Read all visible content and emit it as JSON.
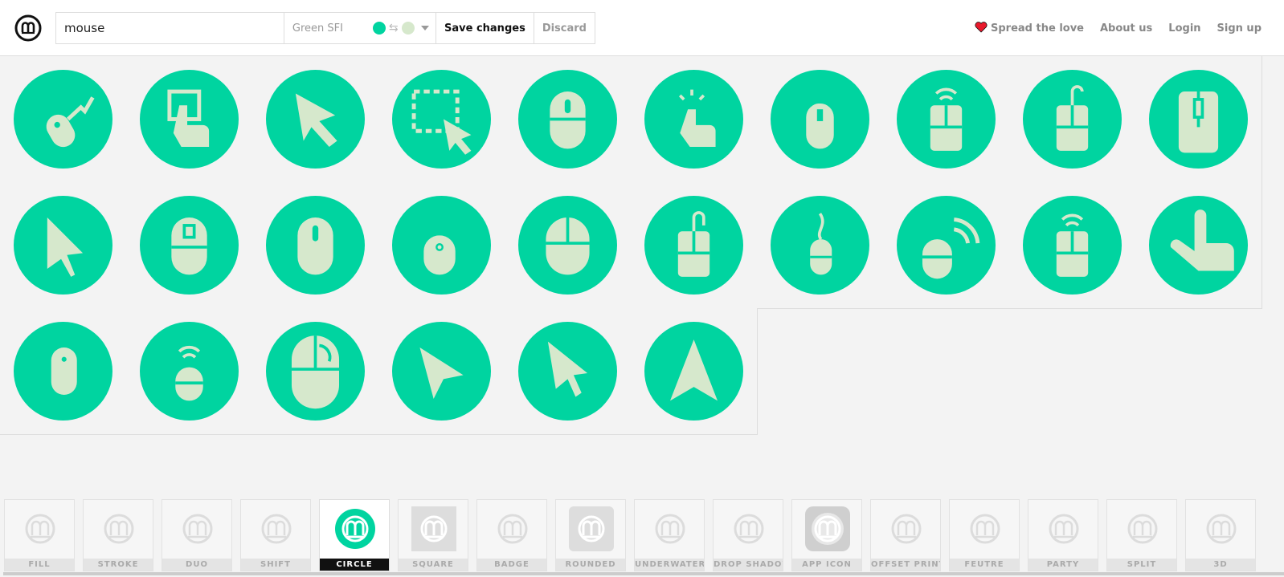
{
  "colors": {
    "accent": "#00d4a0",
    "light": "#d6e8cc",
    "bg": "#f3f3f3"
  },
  "search": {
    "value": "mouse"
  },
  "theme": {
    "name": "Green SFI",
    "primary": "#00d4a0",
    "secondary": "#d6e8cc"
  },
  "toolbar": {
    "save_label": "Save changes",
    "discard_label": "Discard"
  },
  "nav": {
    "spread": "Spread the love",
    "about": "About us",
    "login": "Login",
    "signup": "Sign up"
  },
  "icons": [
    {
      "name": "usb-mouse-icon"
    },
    {
      "name": "touch-screen-icon"
    },
    {
      "name": "cursor-arrow-icon"
    },
    {
      "name": "selection-cursor-icon"
    },
    {
      "name": "mouse-icon"
    },
    {
      "name": "tap-finger-icon"
    },
    {
      "name": "wired-mouse-icon"
    },
    {
      "name": "wireless-mouse-icon"
    },
    {
      "name": "wired-mouse-2-icon"
    },
    {
      "name": "mouse-scroll-icon"
    },
    {
      "name": "pointer-icon"
    },
    {
      "name": "mouse-wheel-icon"
    },
    {
      "name": "mouse-oval-icon"
    },
    {
      "name": "mouse-cable-icon"
    },
    {
      "name": "mouse-buttons-icon"
    },
    {
      "name": "mouse-cable-2-icon"
    },
    {
      "name": "mouse-wire-icon"
    },
    {
      "name": "mouse-signal-icon"
    },
    {
      "name": "wireless-mouse-2-icon"
    },
    {
      "name": "finger-point-icon"
    },
    {
      "name": "mouse-simple-icon"
    },
    {
      "name": "wireless-mouse-3-icon"
    },
    {
      "name": "mouse-large-icon"
    },
    {
      "name": "navigation-pointer-icon"
    },
    {
      "name": "cursor-arrow-2-icon"
    },
    {
      "name": "navigation-arrow-icon"
    }
  ],
  "styles": [
    {
      "label": "FILL"
    },
    {
      "label": "STROKE"
    },
    {
      "label": "DUO"
    },
    {
      "label": "SHIFT"
    },
    {
      "label": "CIRCLE",
      "active": true
    },
    {
      "label": "SQUARE"
    },
    {
      "label": "BADGE"
    },
    {
      "label": "ROUNDED"
    },
    {
      "label": "UNDERWATER"
    },
    {
      "label": "DROP SHADOW"
    },
    {
      "label": "APP ICON"
    },
    {
      "label": "OFFSET PRINT"
    },
    {
      "label": "FEUTRE"
    },
    {
      "label": "PARTY"
    },
    {
      "label": "SPLIT"
    },
    {
      "label": "3D"
    }
  ]
}
